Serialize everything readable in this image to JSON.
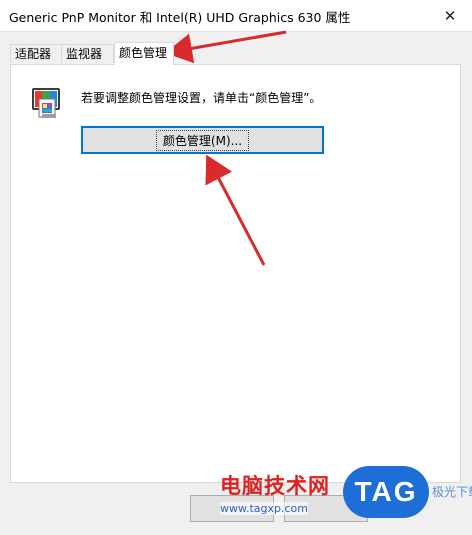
{
  "window": {
    "title": "Generic PnP Monitor 和 Intel(R) UHD Graphics 630 属性",
    "close_glyph": "✕"
  },
  "tabs": [
    {
      "label": "适配器",
      "active": false
    },
    {
      "label": "监视器",
      "active": false
    },
    {
      "label": "颜色管理",
      "active": true
    }
  ],
  "panel": {
    "description": "若要调整颜色管理设置，请单击“颜色管理”。",
    "button_label": "颜色管理(M)...",
    "icon": "color-management-icon"
  },
  "footer": {
    "buttons": [
      "",
      ""
    ]
  },
  "annotations": {
    "arrow_color": "#d92b2b"
  },
  "watermark": {
    "text": "电脑技术网",
    "url": "www.tagxp.com",
    "logo": "TAG",
    "side": "极光下载站"
  }
}
